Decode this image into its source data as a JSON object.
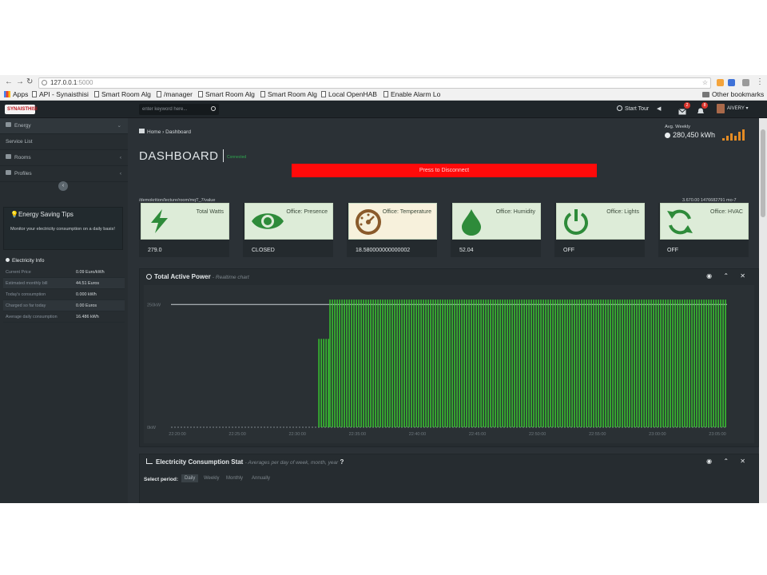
{
  "browser": {
    "url_host": "127.0.0.1",
    "url_port": ":5000",
    "bookmarks": [
      {
        "label": "Apps",
        "kind": "grid"
      },
      {
        "label": "API - Synaisthisi",
        "kind": "page"
      },
      {
        "label": "Smart Room Alg",
        "kind": "page"
      },
      {
        "label": "/manager",
        "kind": "page"
      },
      {
        "label": "Smart Room Alg",
        "kind": "page"
      },
      {
        "label": "Smart Room Alg",
        "kind": "page"
      },
      {
        "label": "Local OpenHAB",
        "kind": "page"
      },
      {
        "label": "Enable Alarm Lo",
        "kind": "page"
      }
    ],
    "other_bookmarks": "Other bookmarks"
  },
  "topbar": {
    "logo_text": "SYNAISTHISI",
    "search_placeholder": "enter keyword here...",
    "start_tour": "Start Tour",
    "mail_badge": "2",
    "alert_badge": "8",
    "user_name": "AIVERY"
  },
  "sidebar": {
    "items": [
      {
        "label": "Energy",
        "icon": "dashboard-icon",
        "chevron": "⌄"
      },
      {
        "label": "Service List",
        "icon": "",
        "chevron": ""
      },
      {
        "label": "Rooms",
        "icon": "rooms-icon",
        "chevron": "‹"
      },
      {
        "label": "Profiles",
        "icon": "profiles-icon",
        "chevron": "‹"
      }
    ],
    "tips_title": "Energy Saving Tips",
    "tips_text": "Monitor your electricity consumption on a daily basis!",
    "info_title": "Electricity Info",
    "info_rows": [
      {
        "label": "Current Price",
        "value": "0.09 Euro/kWh"
      },
      {
        "label": "Estimated monthly bill",
        "value": "44.51 Euros"
      },
      {
        "label": "Today's consumption",
        "value": "0.000 kWh"
      },
      {
        "label": "Charged so far today",
        "value": "0.00 Euros"
      },
      {
        "label": "Average daily consumption",
        "value": "16.486 kWh"
      }
    ]
  },
  "header": {
    "breadcrumb_home": "Home",
    "breadcrumb_sep": "›",
    "breadcrumb_current": "Dashboard",
    "avg_label": "Avg. Weekly",
    "avg_value": "280,450 kWh",
    "title": "DASHBOARD",
    "status": "Connected",
    "disconnect_label": "Press to Disconnect",
    "path_left": "/demokrition/lecture/room/mqT_7/value",
    "path_right": "3.670.00 1476682791 mo-7"
  },
  "tiles": [
    {
      "label": "Total Watts",
      "value": "279.0",
      "icon": "lightning-icon",
      "color": "#2e8b3a"
    },
    {
      "label": "Office: Presence",
      "value": "CLOSED",
      "icon": "eye-icon",
      "color": "#2e8b3a"
    },
    {
      "label": "Office: Temperature",
      "value": "18.580000000000002",
      "icon": "gauge-icon",
      "color": "#8a5a2b"
    },
    {
      "label": "Office: Humidity",
      "value": "52.04",
      "icon": "droplet-icon",
      "color": "#2e8b3a"
    },
    {
      "label": "Office: Lights",
      "value": "OFF",
      "icon": "power-icon",
      "color": "#2e8b3a"
    },
    {
      "label": "Office: HVAC",
      "value": "OFF",
      "icon": "refresh-icon",
      "color": "#2e8b3a"
    }
  ],
  "power_panel": {
    "title": "Total Active Power",
    "subtitle": "- Realtime chart",
    "tools": "◉ ⌃ ✕"
  },
  "stat_panel": {
    "title": "Electricity Consumption Stat",
    "subtitle": "- Averages per day of week, month, year",
    "select_label": "Select period:",
    "periods": [
      "Daily",
      "Weekly",
      "Monthly",
      "Annually"
    ],
    "active_period": "Daily",
    "tools": "◉ ⌃ ✕"
  },
  "colors": {
    "accent_green": "#39d22f",
    "disconnect_red": "#ff0a0a",
    "dark_bg": "#2b3136"
  },
  "chart_data": {
    "type": "bar",
    "title": "Total Active Power",
    "subtitle": "Realtime chart",
    "y_ticks": [
      "250kW",
      "0kW"
    ],
    "x_ticks": [
      "22:20:00",
      "22:25:00",
      "22:30:00",
      "22:35:00",
      "22:40:00",
      "22:45:00",
      "22:50:00",
      "22:55:00",
      "23:00:00",
      "23:05:00"
    ],
    "ylim": [
      0,
      270
    ],
    "series": [
      {
        "phases": [
          {
            "from_x": 0.0,
            "to_x": 0.265,
            "value": 0
          },
          {
            "from_x": 0.265,
            "to_x": 0.285,
            "value": 180
          },
          {
            "from_x": 0.285,
            "to_x": 1.0,
            "value": 260
          }
        ]
      }
    ],
    "reference_line": 250,
    "grid": false
  }
}
